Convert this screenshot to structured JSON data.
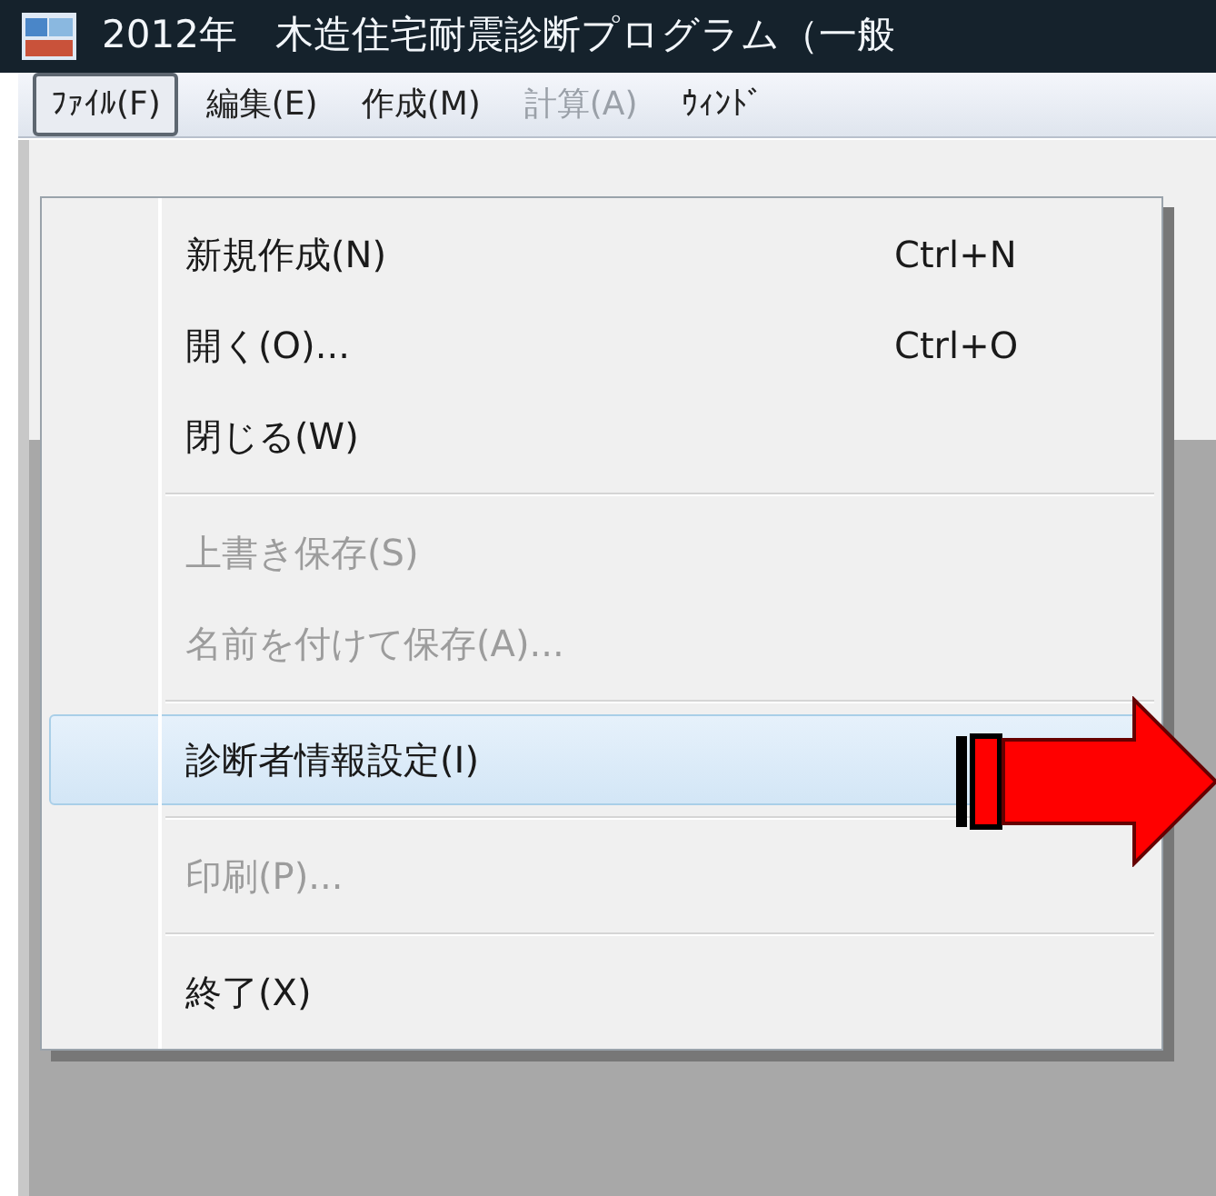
{
  "window": {
    "title": "2012年　木造住宅耐震診断プログラム（一般"
  },
  "menu_bar": [
    {
      "label": "ﾌｧｲﾙ(F)",
      "selected": true,
      "disabled": false
    },
    {
      "label": "編集(E)",
      "selected": false,
      "disabled": false
    },
    {
      "label": "作成(M)",
      "selected": false,
      "disabled": false
    },
    {
      "label": "計算(A)",
      "selected": false,
      "disabled": true
    },
    {
      "label": "ｳｨﾝﾄﾞ",
      "selected": false,
      "disabled": false
    }
  ],
  "file_menu": [
    {
      "kind": "item",
      "label": "新規作成(N)",
      "shortcut": "Ctrl+N",
      "disabled": false,
      "selected": false
    },
    {
      "kind": "item",
      "label": "開く(O)...",
      "shortcut": "Ctrl+O",
      "disabled": false,
      "selected": false
    },
    {
      "kind": "item",
      "label": "閉じる(W)",
      "disabled": false,
      "selected": false
    },
    {
      "kind": "separator"
    },
    {
      "kind": "item",
      "label": "上書き保存(S)",
      "disabled": true,
      "selected": false
    },
    {
      "kind": "item",
      "label": "名前を付けて保存(A)...",
      "disabled": true,
      "selected": false
    },
    {
      "kind": "separator"
    },
    {
      "kind": "item",
      "label": "診断者情報設定(I)",
      "disabled": false,
      "selected": true
    },
    {
      "kind": "separator"
    },
    {
      "kind": "item",
      "label": "印刷(P)...",
      "disabled": true,
      "selected": false
    },
    {
      "kind": "separator"
    },
    {
      "kind": "item",
      "label": "終了(X)",
      "disabled": false,
      "selected": false
    }
  ]
}
